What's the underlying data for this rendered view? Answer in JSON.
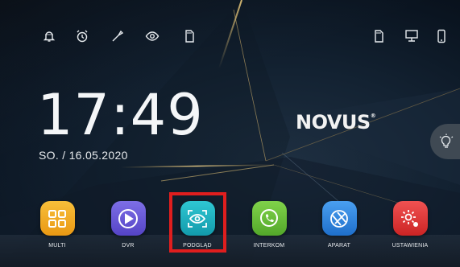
{
  "status_icons": [
    {
      "name": "bell-icon"
    },
    {
      "name": "alarm-clock-icon"
    },
    {
      "name": "tool-icon"
    },
    {
      "name": "eye-icon"
    },
    {
      "name": "sd-card-icon"
    }
  ],
  "status_icons_right": [
    {
      "name": "sd-card-right-icon"
    },
    {
      "name": "monitor-network-icon"
    },
    {
      "name": "phone-icon"
    }
  ],
  "clock": {
    "time": "17:49",
    "date": "SO. / 16.05.2020"
  },
  "logo": {
    "text": "NOVUS",
    "mark": "®"
  },
  "apps": [
    {
      "label": "MULTI",
      "icon": "grid-icon",
      "color": "#f2a81d"
    },
    {
      "label": "DVR",
      "icon": "play-icon",
      "color": "#6b5bd6"
    },
    {
      "label": "PODGLĄD",
      "icon": "eye-preview-icon",
      "color": "#1cb3c2"
    },
    {
      "label": "INTERKOM",
      "icon": "intercom-phone-icon",
      "color": "#6cc23a"
    },
    {
      "label": "APARAT",
      "icon": "camera-icon",
      "color": "#2f86e0"
    },
    {
      "label": "USTAWIENIA",
      "icon": "settings-gear-icon",
      "color": "#e23a3a"
    }
  ]
}
